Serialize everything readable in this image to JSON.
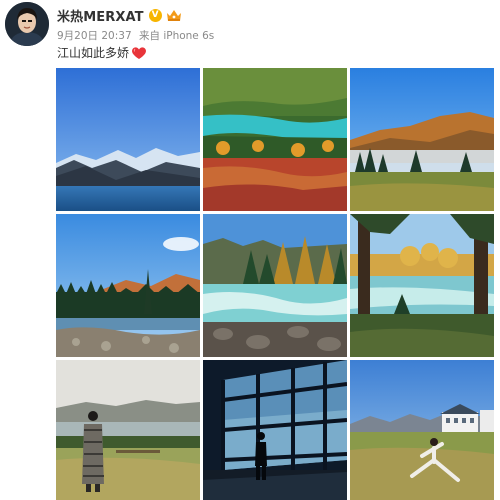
{
  "post": {
    "username": "米热MERXAT",
    "verified_badge": "V",
    "date": "9月20日 20:37",
    "source": "来自 iPhone 6s",
    "caption": "江山如此多娇",
    "icons": {
      "avatar": "avatar-photo",
      "verified": "verified-badge-icon",
      "vip": "vip-crown-icon",
      "heart": "heart-emoji-icon"
    },
    "colors": {
      "username": "#333333",
      "meta": "#8a8a8a",
      "verified": "#f7b500",
      "heart": "#e8343a"
    }
  },
  "photos": [
    {
      "subject": "lake-mountains"
    },
    {
      "subject": "turquoise-river-forest"
    },
    {
      "subject": "misty-mountain-valley"
    },
    {
      "subject": "shore-pine-forest"
    },
    {
      "subject": "rapids-river"
    },
    {
      "subject": "river-through-trees"
    },
    {
      "subject": "woman-by-lake"
    },
    {
      "subject": "airport-terminal-window"
    },
    {
      "subject": "woman-yoga-pose-field"
    }
  ]
}
